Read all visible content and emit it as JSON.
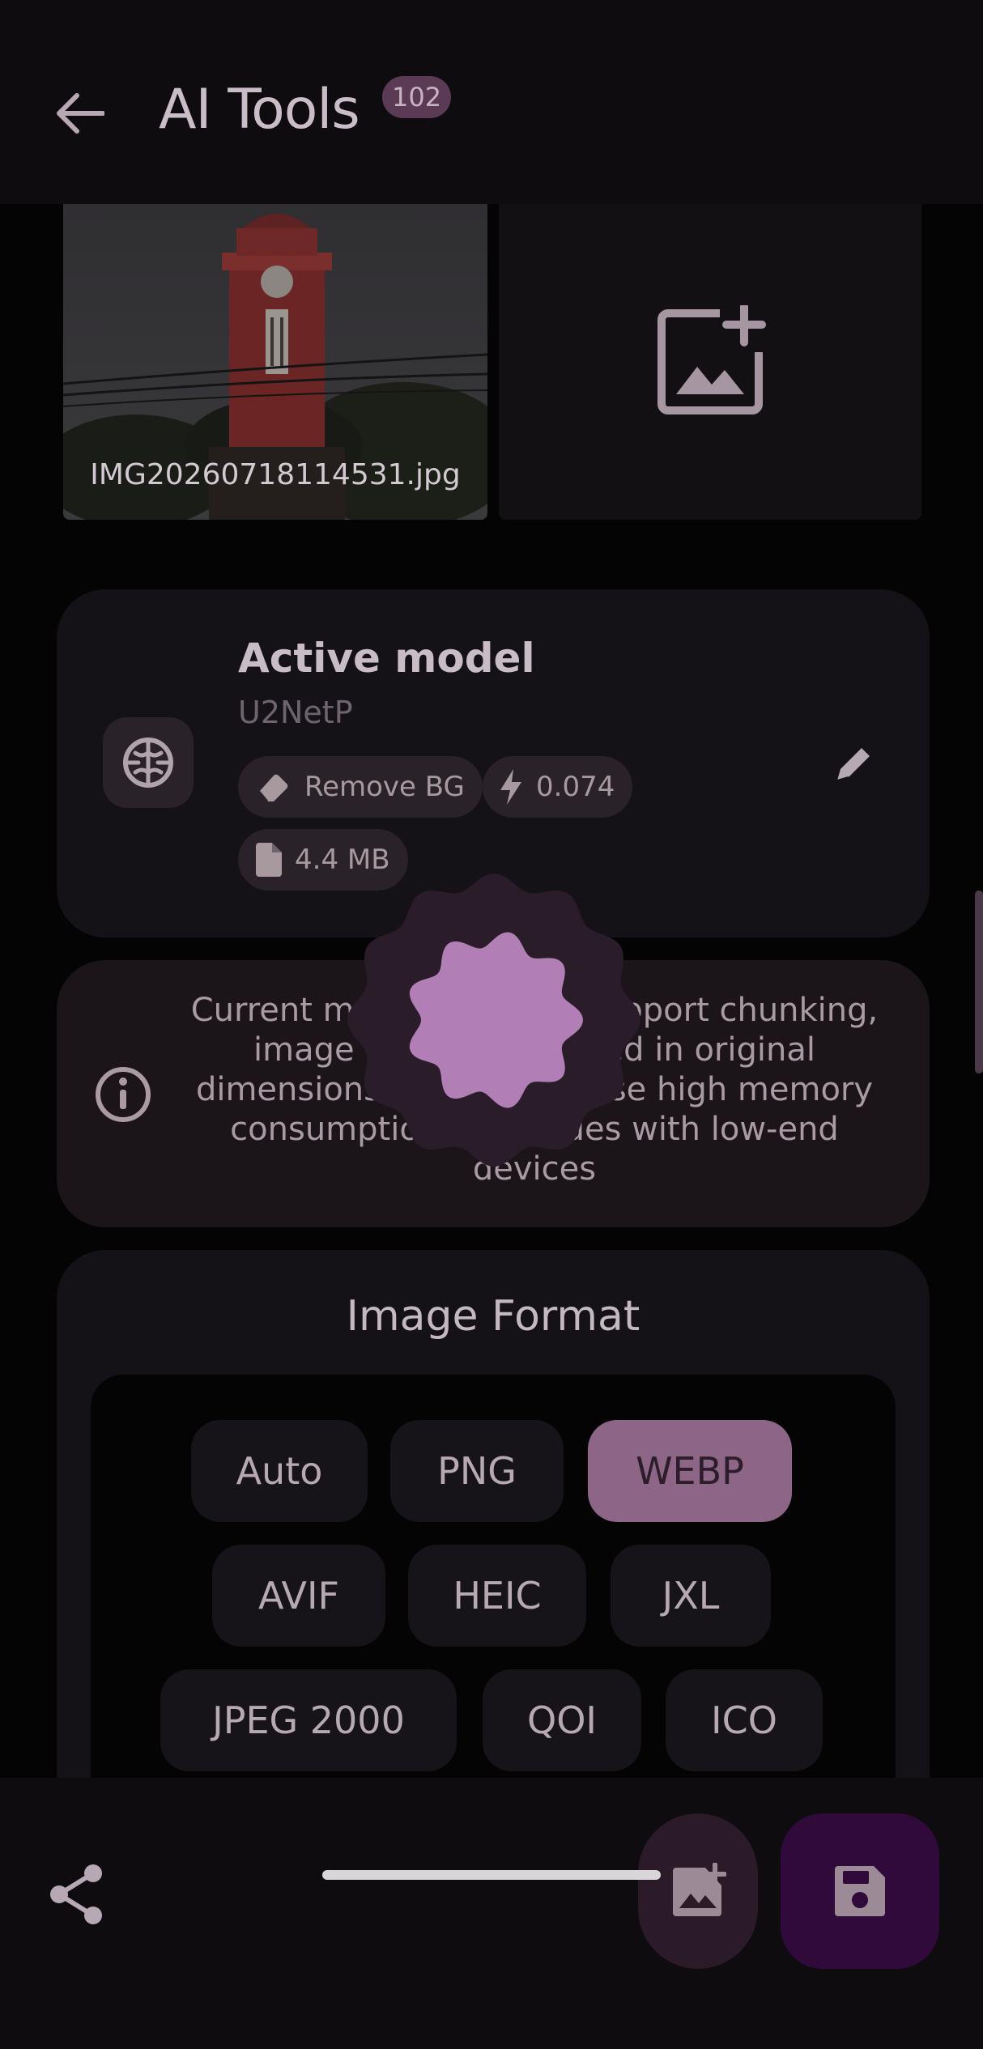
{
  "appbar": {
    "title": "AI Tools",
    "badge": "102"
  },
  "images": {
    "filename": "IMG20260718114531.jpg"
  },
  "model": {
    "heading": "Active model",
    "name": "U2NetP",
    "chips": {
      "task": "Remove BG",
      "score": "0.074",
      "size": "4.4 MB"
    }
  },
  "info": {
    "message": "Current model does not support chunking, image will be processed in original dimensions, this may cause high memory consumption and issues with low-end devices"
  },
  "format": {
    "title": "Image Format",
    "options": [
      "Auto",
      "PNG",
      "WEBP",
      "AVIF",
      "HEIC",
      "JXL",
      "JPEG 2000",
      "QOI",
      "ICO"
    ],
    "selected": "WEBP"
  },
  "colors": {
    "accent": "#8c6587",
    "save_fab": "#2f0a3a",
    "loader": "#b17fb6"
  }
}
